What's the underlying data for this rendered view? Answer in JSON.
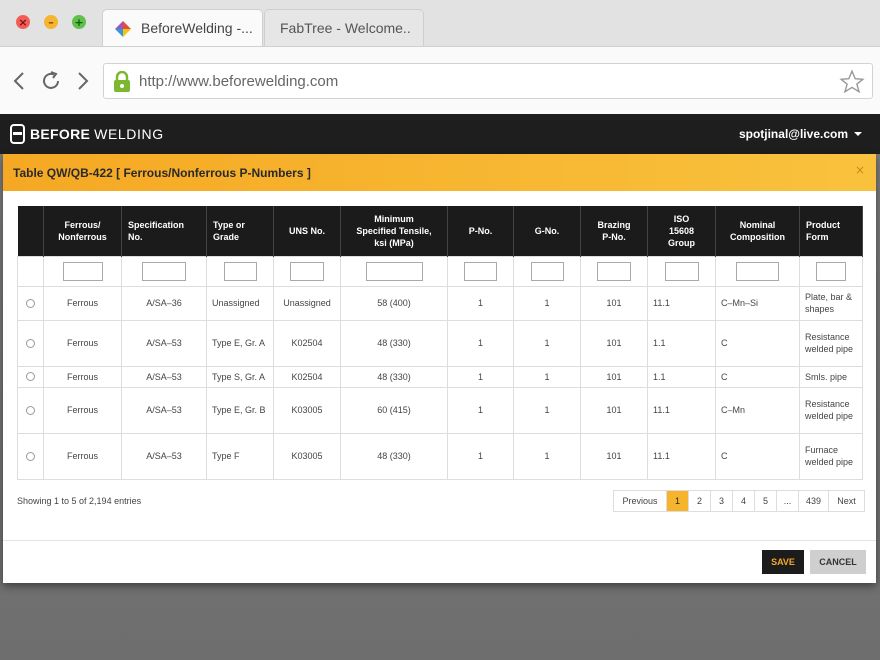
{
  "browser": {
    "tabs": [
      {
        "label": "BeforeWelding -..."
      },
      {
        "label": "FabTree - Welcome.."
      }
    ],
    "url": "http://www.beforewelding.com",
    "window_buttons": {
      "close": "×",
      "minimize": "–",
      "maximize": "+"
    }
  },
  "site": {
    "logo_bold": "BEFORE",
    "logo_light": "WELDING",
    "user_email": "spotjinal@live.com"
  },
  "modal": {
    "title": "Table QW/QB-422 [ Ferrous/Nonferrous P-Numbers ]",
    "close": "×",
    "columns": [
      {
        "line1": "Ferrous/",
        "line2": "Nonferrous"
      },
      {
        "line1": "Specification",
        "line2": "No."
      },
      {
        "line1": "Type or",
        "line2": "Grade"
      },
      {
        "line1": "UNS No.",
        "line2": ""
      },
      {
        "line1": "Minimum",
        "line2": "Specified Tensile,",
        "line3": "ksi (MPa)"
      },
      {
        "line1": "P-No.",
        "line2": ""
      },
      {
        "line1": "G-No.",
        "line2": ""
      },
      {
        "line1": "Brazing",
        "line2": "P-No."
      },
      {
        "line1": "ISO",
        "line2": "15608",
        "line3": "Group"
      },
      {
        "line1": "Nominal",
        "line2": "Composition"
      },
      {
        "line1": "Product",
        "line2": "Form"
      }
    ],
    "rows": [
      {
        "ferrous": "Ferrous",
        "spec": "A/SA–36",
        "type": "Unassigned",
        "uns": "Unassigned",
        "tensile": "58 (400)",
        "pno": "1",
        "gno": "1",
        "brazing": "101",
        "iso": "11.1",
        "composition": "C–Mn–Si",
        "form": "Plate, bar & shapes"
      },
      {
        "ferrous": "Ferrous",
        "spec": "A/SA–53",
        "type": "Type E, Gr. A",
        "uns": "K02504",
        "tensile": "48 (330)",
        "pno": "1",
        "gno": "1",
        "brazing": "101",
        "iso": "1.1",
        "composition": "C",
        "form": "Resistance welded pipe"
      },
      {
        "ferrous": "Ferrous",
        "spec": "A/SA–53",
        "type": "Type S, Gr. A",
        "uns": "K02504",
        "tensile": "48 (330)",
        "pno": "1",
        "gno": "1",
        "brazing": "101",
        "iso": "1.1",
        "composition": "C",
        "form": "Smls. pipe"
      },
      {
        "ferrous": "Ferrous",
        "spec": "A/SA–53",
        "type": "Type E, Gr. B",
        "uns": "K03005",
        "tensile": "60 (415)",
        "pno": "1",
        "gno": "1",
        "brazing": "101",
        "iso": "11.1",
        "composition": "C–Mn",
        "form": "Resistance welded pipe"
      },
      {
        "ferrous": "Ferrous",
        "spec": "A/SA–53",
        "type": "Type F",
        "uns": "K03005",
        "tensile": "48 (330)",
        "pno": "1",
        "gno": "1",
        "brazing": "101",
        "iso": "11.1",
        "composition": "C",
        "form": "Furnace welded pipe"
      }
    ],
    "entries_text": "Showing 1 to 5 of 2,194 entries",
    "pagination": [
      "Previous",
      "1",
      "2",
      "3",
      "4",
      "5",
      "...",
      "439",
      "Next"
    ],
    "active_page": "1",
    "save_label": "SAVE",
    "cancel_label": "CANCEL"
  },
  "colors": {
    "accent": "#f6b42d",
    "header_bg": "#1e1e1e"
  }
}
